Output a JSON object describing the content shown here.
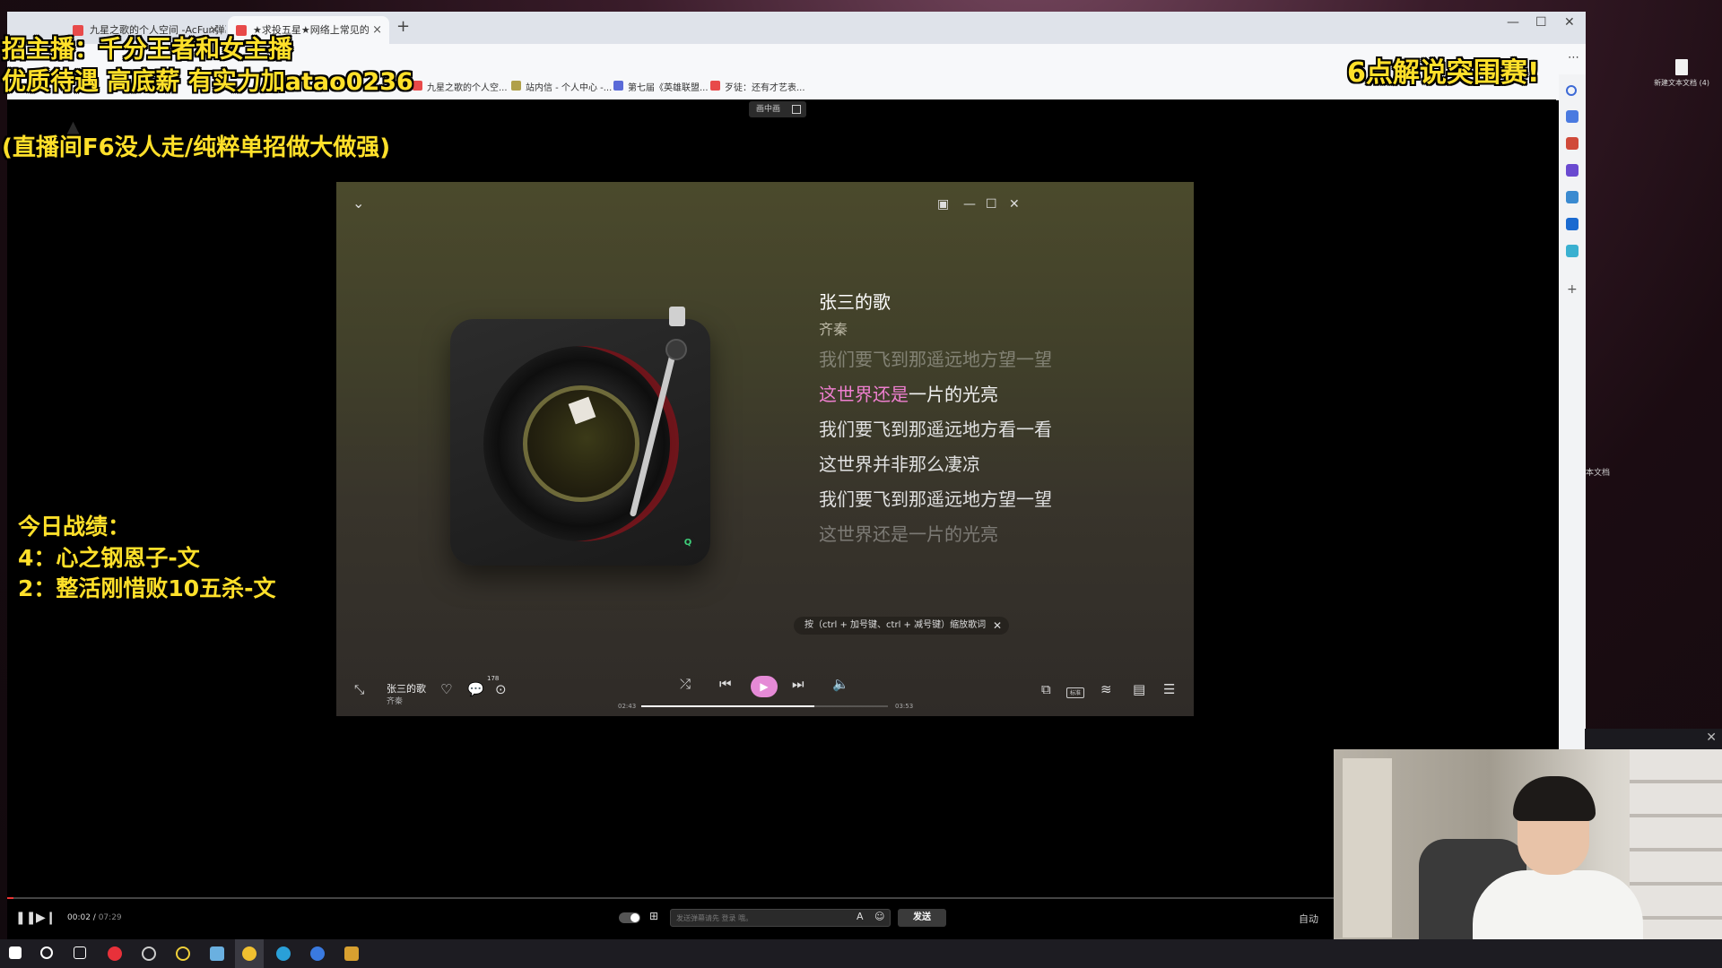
{
  "browser": {
    "tabs": [
      {
        "label": "九星之歌的个人空间 -AcFun弹幕",
        "active": false
      },
      {
        "label": "★求投五星★网络上常见的",
        "active": true
      }
    ],
    "bookmarks": [
      "九星之歌的个人空...",
      "站内信 - 个人中心 -...",
      "第七届《英雄联盟...",
      "歹徒：还有才艺表..."
    ]
  },
  "overlays": {
    "recruit_line1": "招主播：千分王者和女主播",
    "recruit_line2": "优质待遇 高底薪 有实力加atao0236",
    "note": "(直播间F6没人走/纯粹单招做大做强)",
    "event": "6点解说突围赛!",
    "record_title": "今日战绩：",
    "record_1": "4：心之钢恩子-文",
    "record_2": "2：整活刚惜败10五杀-文"
  },
  "pip_badge": "画中画",
  "player": {
    "song_title": "张三的歌",
    "artist": "齐秦",
    "lyrics": {
      "prev": "我们要飞到那遥远地方望一望",
      "current_sung": "这世界还是",
      "current_rest": "一片的光亮",
      "next1": "我们要飞到那遥远地方看一看",
      "next2": "这世界并非那么凄凉",
      "next3": "我们要飞到那遥远地方望一望",
      "next4": "这世界还是一片的光亮"
    },
    "hint": "按（ctrl + 加号键、ctrl + 减号键）缩放歌词",
    "time_current": "02:43",
    "time_total": "03:53",
    "progress": 0.7,
    "badge": "标准",
    "comment_count": "178"
  },
  "video": {
    "time_current": "00:02",
    "time_total": "07:29",
    "progress": 0.004,
    "danmu_placeholder": "发送弹幕请先 登录 哦。",
    "send_label": "发送",
    "auto_label": "自动"
  },
  "desktop": {
    "file_label": "新建文本文档 (4)",
    "side_text": "本文档"
  },
  "colors": {
    "overlay_yellow": "#ffe02a",
    "lyric_highlight": "#ee7fcf",
    "play_button": "#e58ad6"
  }
}
